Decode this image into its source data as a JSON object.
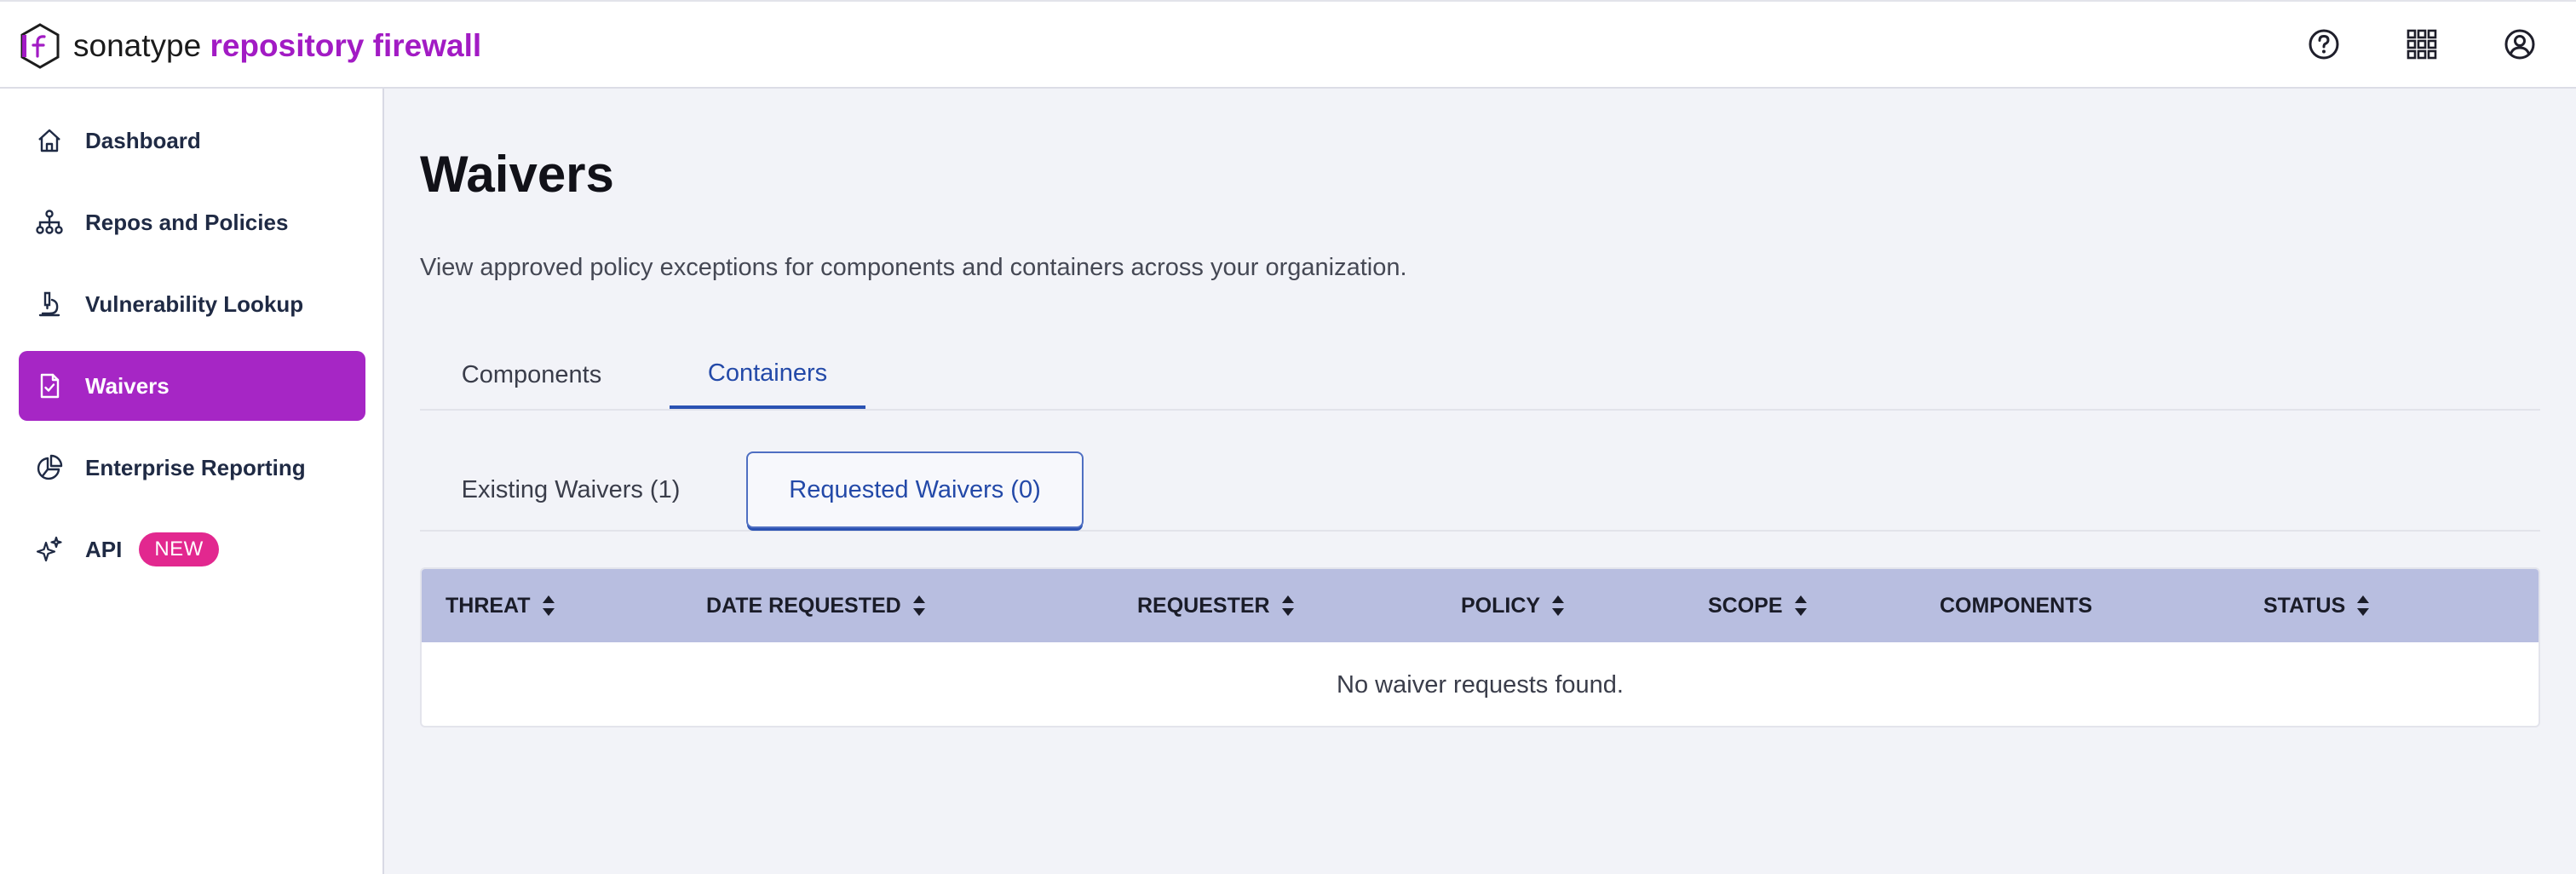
{
  "header": {
    "brand": "sonatype",
    "product": "repository firewall",
    "icons": [
      "help-circle-icon",
      "apps-grid-icon",
      "user-account-icon"
    ]
  },
  "sidebar": {
    "items": [
      {
        "label": "Dashboard",
        "icon": "home-icon",
        "active": false
      },
      {
        "label": "Repos and Policies",
        "icon": "hierarchy-icon",
        "active": false
      },
      {
        "label": "Vulnerability Lookup",
        "icon": "microscope-icon",
        "active": false
      },
      {
        "label": "Waivers",
        "icon": "document-check-icon",
        "active": true
      },
      {
        "label": "Enterprise Reporting",
        "icon": "pie-chart-icon",
        "active": false
      },
      {
        "label": "API",
        "icon": "sparkle-icon",
        "active": false,
        "badge": "NEW"
      }
    ]
  },
  "main": {
    "title": "Waivers",
    "description": "View approved policy exceptions for components and containers across your organization.",
    "tabs": [
      {
        "label": "Components",
        "active": false
      },
      {
        "label": "Containers",
        "active": true
      }
    ],
    "subtabs": [
      {
        "label": "Existing Waivers (1)",
        "active": false
      },
      {
        "label": "Requested Waivers (0)",
        "active": true
      }
    ],
    "table": {
      "columns": [
        {
          "label": "THREAT",
          "sortable": true
        },
        {
          "label": "DATE REQUESTED",
          "sortable": true
        },
        {
          "label": "REQUESTER",
          "sortable": true
        },
        {
          "label": "POLICY",
          "sortable": true
        },
        {
          "label": "SCOPE",
          "sortable": true
        },
        {
          "label": "COMPONENTS",
          "sortable": false
        },
        {
          "label": "STATUS",
          "sortable": true
        }
      ],
      "empty_message": "No waiver requests found."
    }
  },
  "colors": {
    "brand_purple": "#a626c5",
    "link_blue": "#2349a8",
    "header_row": "#b8bee0",
    "badge_pink": "#e2288f"
  }
}
